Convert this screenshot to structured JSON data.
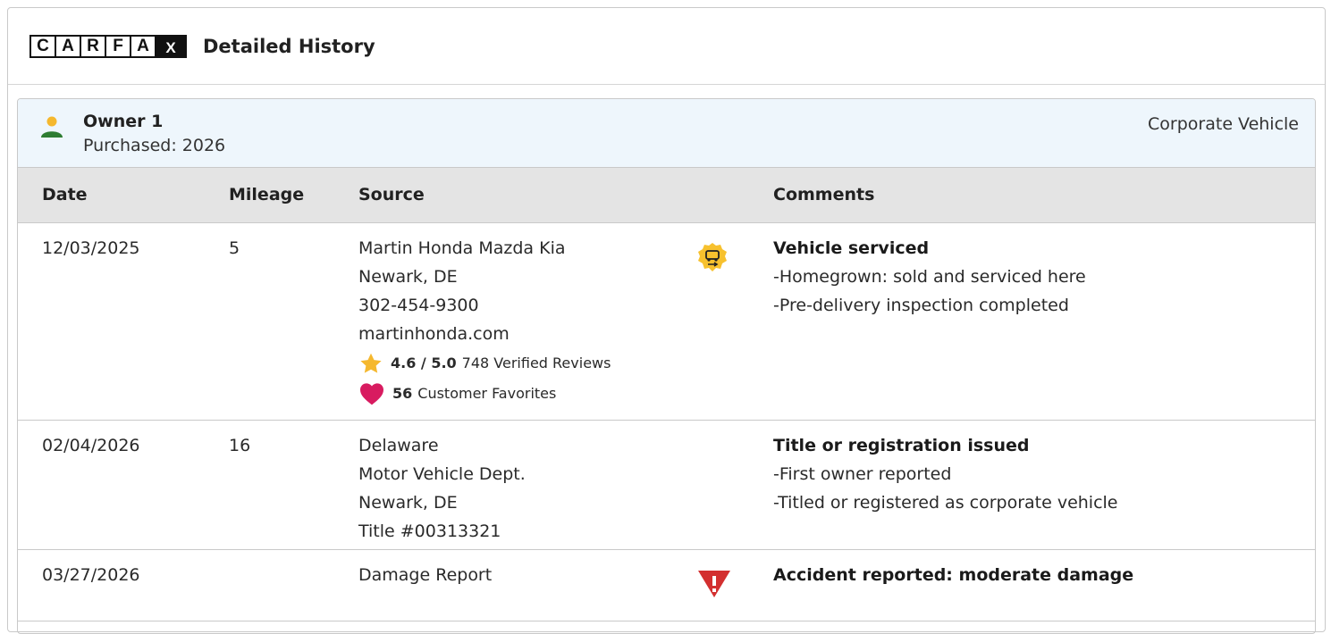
{
  "header": {
    "logo_letters": [
      "C",
      "A",
      "R",
      "F",
      "A",
      "X"
    ],
    "title": "Detailed History"
  },
  "owner": {
    "name": "Owner 1",
    "purchased": "Purchased: 2026",
    "type": "Corporate Vehicle"
  },
  "table": {
    "columns": [
      "Date",
      "Mileage",
      "Source",
      "Comments"
    ],
    "rows": [
      {
        "date": "12/03/2025",
        "mileage": "5",
        "source": [
          "Martin Honda Mazda Kia",
          "Newark, DE",
          "302-454-9300",
          "martinhonda.com"
        ],
        "rating": {
          "score": "4.6 / 5.0",
          "reviews": "748 Verified Reviews"
        },
        "favorites": {
          "count": "56",
          "label": "Customer Favorites"
        },
        "icon": "service-icon",
        "comment_title": "Vehicle serviced",
        "comments": [
          "-Homegrown: sold and serviced here",
          "-Pre-delivery inspection completed"
        ]
      },
      {
        "date": "02/04/2026",
        "mileage": "16",
        "source": [
          "Delaware",
          "Motor Vehicle Dept.",
          "Newark, DE",
          "Title #00313321"
        ],
        "comment_title": "Title or registration issued",
        "comments": [
          "-First owner reported",
          "-Titled or registered as corporate vehicle"
        ]
      },
      {
        "date": "03/27/2026",
        "mileage": "",
        "source": [
          "Damage Report"
        ],
        "icon": "warning-icon",
        "comment_title": "Accident reported: moderate damage",
        "comments": []
      }
    ]
  },
  "colors": {
    "owner_bar": "#eef6fc",
    "header_row": "#e4e4e4",
    "service_icon": "#f7c12e",
    "warning_icon": "#d32f2f",
    "star": "#f5b82e",
    "heart": "#d81b60",
    "owner_icon_head": "#f5b82e",
    "owner_icon_body": "#2e7d32"
  }
}
